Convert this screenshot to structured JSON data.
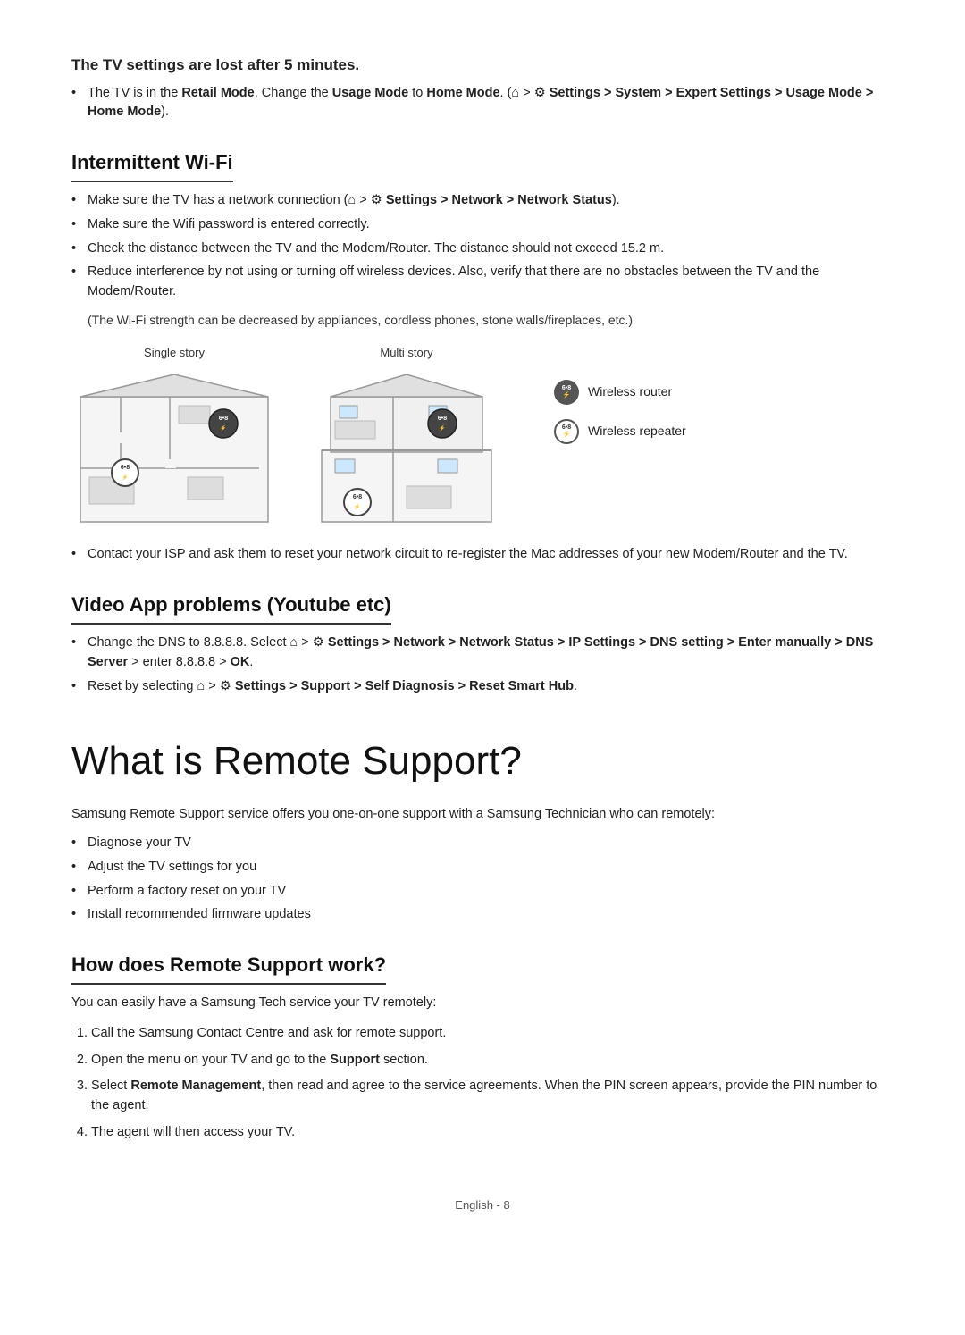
{
  "sections": {
    "tv_settings_lost": {
      "title": "The TV settings are lost after 5 minutes.",
      "bullets": [
        {
          "text_parts": [
            {
              "text": "The TV is in the ",
              "bold": false
            },
            {
              "text": "Retail Mode",
              "bold": true
            },
            {
              "text": ". Change the ",
              "bold": false
            },
            {
              "text": "Usage Mode",
              "bold": true
            },
            {
              "text": " to ",
              "bold": false
            },
            {
              "text": "Home Mode",
              "bold": true
            },
            {
              "text": ". (",
              "bold": false
            },
            {
              "text": "⌂",
              "bold": false,
              "icon": true
            },
            {
              "text": " > ⚙ Settings > System > Expert Settings > Usage Mode > Home Mode",
              "bold": true
            },
            {
              "text": ").",
              "bold": false
            }
          ]
        }
      ]
    },
    "intermittent_wifi": {
      "title": "Intermittent Wi-Fi",
      "bullets": [
        "Make sure the TV has a network connection (⌂ > ⚙ Settings > Network > Network Status).",
        "Make sure the Wifi password is entered correctly.",
        "Check the distance between the TV and the Modem/Router. The distance should not exceed 15.2 m.",
        "Reduce interference by not using or turning off wireless devices. Also, verify that there are no obstacles between the TV and the Modem/Router."
      ],
      "note": "(The Wi-Fi strength can be decreased by appliances, cordless phones, stone walls/fireplaces, etc.)",
      "diagram": {
        "single_story_label": "Single story",
        "multi_story_label": "Multi story",
        "legend": [
          {
            "label": "Wireless router",
            "type": "router"
          },
          {
            "label": "Wireless repeater",
            "type": "repeater"
          }
        ]
      },
      "extra_bullet": "Contact your ISP and ask them to reset your network circuit to re-register the Mac addresses of your new Modem/Router and the TV."
    },
    "video_app": {
      "title": "Video App problems (Youtube etc)",
      "bullets": [
        {
          "rich": true,
          "parts": [
            "Change the DNS to 8.8.8.8. Select ",
            "HOME_ICON",
            " > ",
            "GEAR_ICON",
            " Settings > Network > Network Status > IP Settings > DNS setting > Enter manually > DNS Server",
            " > enter 8.8.8.8 > ",
            "OK",
            "."
          ]
        },
        {
          "rich": true,
          "parts": [
            "Reset by selecting ",
            "HOME_ICON",
            " > ",
            "GEAR_ICON",
            " Settings > Support > Self Diagnosis > Reset Smart Hub",
            "."
          ]
        }
      ]
    },
    "remote_support": {
      "title": "What is Remote Support?",
      "intro": "Samsung Remote Support service offers you one-on-one support with a Samsung Technician who can remotely:",
      "bullets": [
        "Diagnose your TV",
        "Adjust the TV settings for you",
        "Perform a factory reset on your TV",
        "Install recommended firmware updates"
      ]
    },
    "how_remote_support": {
      "title": "How does Remote Support work?",
      "intro": "You can easily have a Samsung Tech service your TV remotely:",
      "steps": [
        "Call the Samsung Contact Centre and ask for remote support.",
        {
          "parts": [
            "Open the menu on your TV and go to the ",
            "Support",
            " section."
          ]
        },
        {
          "parts": [
            "Select ",
            "Remote Management",
            ", then read and agree to the service agreements. When the PIN screen appears, provide the PIN number to the agent."
          ]
        },
        "The agent will then access your TV."
      ]
    }
  },
  "footer": {
    "text": "English - 8"
  }
}
